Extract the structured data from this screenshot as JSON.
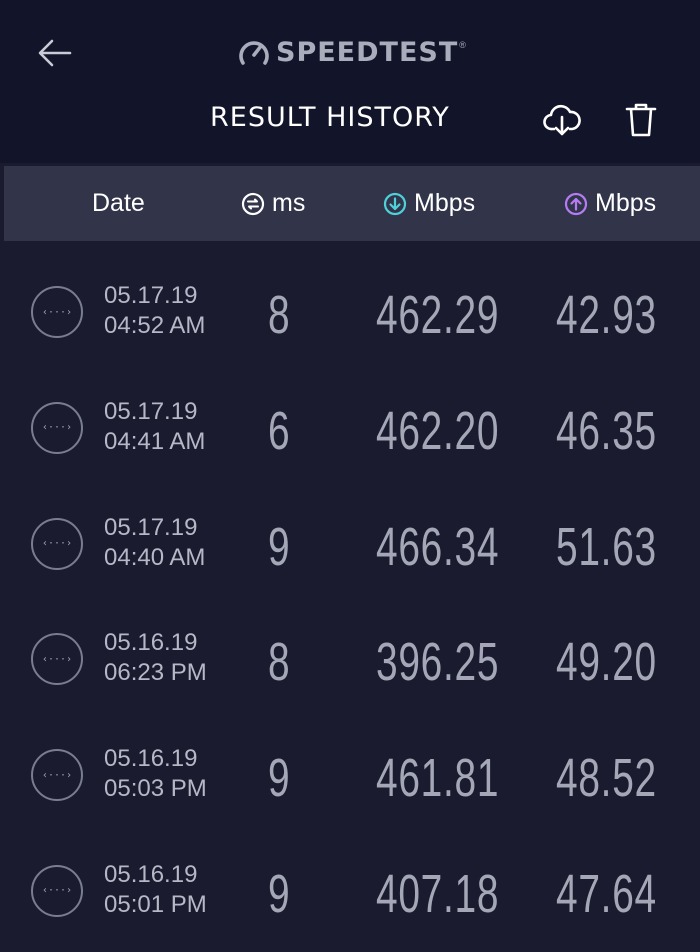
{
  "header": {
    "brand": "SPEEDTEST",
    "trademark": "®",
    "title": "RESULT HISTORY"
  },
  "columns": {
    "date": "Date",
    "ping": "ms",
    "download": "Mbps",
    "upload": "Mbps"
  },
  "icons": {
    "back": "arrow-left-icon",
    "download_history": "cloud-download-icon",
    "delete": "trash-icon",
    "ping": "ping-icon",
    "download": "arrow-down-circle-icon",
    "upload": "arrow-up-circle-icon",
    "connection": "connection-dots-icon"
  },
  "colors": {
    "background": "#1a1b2e",
    "topbar": "#12142a",
    "header_row": "#32354a",
    "download_accent": "#4fd1d9",
    "upload_accent": "#b57cf2"
  },
  "results": [
    {
      "date": "05.17.19",
      "time": "04:52 AM",
      "ping": "8",
      "download": "462.29",
      "upload": "42.93"
    },
    {
      "date": "05.17.19",
      "time": "04:41 AM",
      "ping": "6",
      "download": "462.20",
      "upload": "46.35"
    },
    {
      "date": "05.17.19",
      "time": "04:40 AM",
      "ping": "9",
      "download": "466.34",
      "upload": "51.63"
    },
    {
      "date": "05.16.19",
      "time": "06:23 PM",
      "ping": "8",
      "download": "396.25",
      "upload": "49.20"
    },
    {
      "date": "05.16.19",
      "time": "05:03 PM",
      "ping": "9",
      "download": "461.81",
      "upload": "48.52"
    },
    {
      "date": "05.16.19",
      "time": "05:01 PM",
      "ping": "9",
      "download": "407.18",
      "upload": "47.64"
    }
  ]
}
